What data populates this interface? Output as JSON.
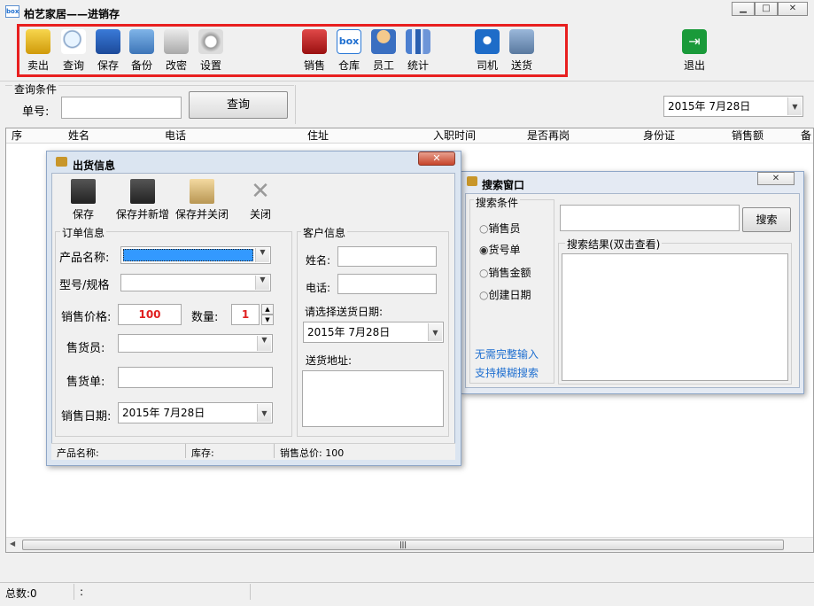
{
  "window": {
    "title": "柏艺家居——进销存",
    "app_icon": "box"
  },
  "toolbar": {
    "items": [
      {
        "label": "卖出",
        "icon": "basket-icon"
      },
      {
        "label": "查询",
        "icon": "magnifier-icon"
      },
      {
        "label": "保存",
        "icon": "save-icon"
      },
      {
        "label": "备份",
        "icon": "backup-icon"
      },
      {
        "label": "改密",
        "icon": "lock-icon"
      },
      {
        "label": "设置",
        "icon": "gear-icon"
      },
      {
        "label": "销售",
        "icon": "shopping-basket-icon"
      },
      {
        "label": "仓库",
        "icon": "box-icon"
      },
      {
        "label": "员工",
        "icon": "person-icon"
      },
      {
        "label": "统计",
        "icon": "bar-chart-icon"
      },
      {
        "label": "司机",
        "icon": "bird-icon"
      },
      {
        "label": "送货",
        "icon": "truck-icon"
      }
    ],
    "exit_label": "退出"
  },
  "query": {
    "group_label": "查询条件",
    "order_no_label": "单号:",
    "order_no_value": "",
    "button": "查询",
    "date": "2015年  7月28日"
  },
  "grid": {
    "columns": [
      "序",
      "姓名",
      "电话",
      "住址",
      "入职时间",
      "是否再岗",
      "身份证",
      "销售额",
      "备"
    ]
  },
  "status": {
    "total": "总数:0",
    "sep": ":"
  },
  "ship_dialog": {
    "title": "出货信息",
    "toolbar": [
      "保存",
      "保存并新增",
      "保存并关闭",
      "关闭"
    ],
    "order_group": "订单信息",
    "product_name_label": "产品名称:",
    "model_label": "型号/规格",
    "price_label": "销售价格:",
    "price_value": "100",
    "qty_label": "数量:",
    "qty_value": "1",
    "seller_label": "售货员:",
    "ticket_label": "售货单:",
    "sale_date_label": "销售日期:",
    "sale_date_value": "2015年  7月28日",
    "customer_group": "客户信息",
    "name_label": "姓名:",
    "phone_label": "电话:",
    "delivery_date_label": "请选择送货日期:",
    "delivery_date_value": "2015年  7月28日",
    "address_label": "送货地址:",
    "status_product": "产品名称:",
    "status_stock": "库存:",
    "status_total": "销售总价: 100"
  },
  "search_dialog": {
    "title": "搜索窗口",
    "criteria_label": "搜索条件",
    "options": [
      "销售员",
      "货号单",
      "销售金额",
      "创建日期"
    ],
    "selected": "货号单",
    "hint1": "无需完整输入",
    "hint2": "支持模糊搜索",
    "search_button": "搜索",
    "results_label": "搜索结果(双击查看)"
  },
  "colors": {
    "highlight_border": "#e81f1f",
    "accent_blue": "#3399ff",
    "value_red": "#e02020",
    "link_blue": "#1f6fd0"
  }
}
